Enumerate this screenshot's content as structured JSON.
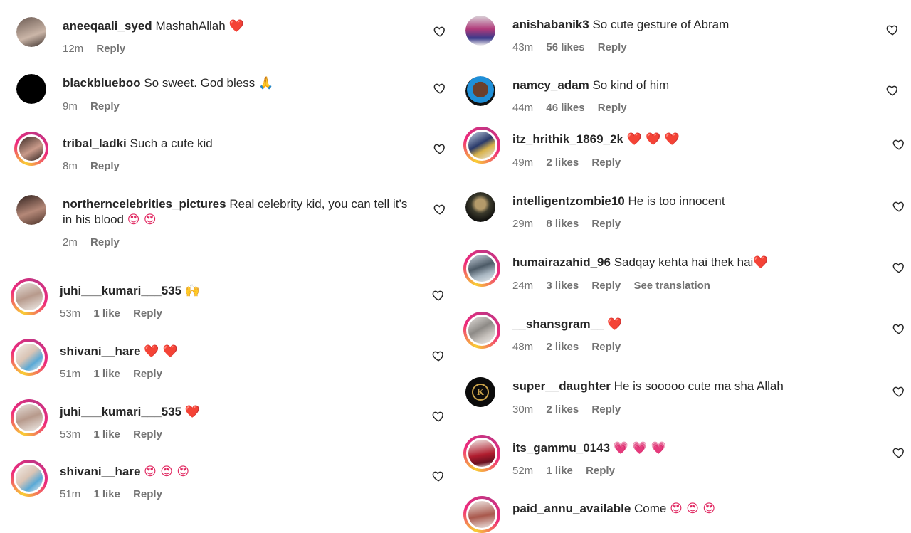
{
  "left_comments": [
    {
      "user": "aneeqaali_syed",
      "text": "MashahAllah",
      "emoji": "❤️",
      "time": "12m",
      "likes": "",
      "reply": "Reply"
    },
    {
      "user": "blackblueboo",
      "text": "So sweet. God bless",
      "emoji": "🙏",
      "time": "9m",
      "likes": "",
      "reply": "Reply"
    },
    {
      "user": "tribal_ladki",
      "text": "Such a cute kid",
      "emoji": "",
      "time": "8m",
      "likes": "",
      "reply": "Reply"
    },
    {
      "user": "northerncelebrities_pictures",
      "text": "Real celebrity kid, you can tell it’s in his blood",
      "emoji": "😍 😍",
      "time": "2m",
      "likes": "",
      "reply": "Reply"
    },
    {
      "user": "juhi___kumari___535",
      "text": "",
      "emoji": "🙌",
      "time": "53m",
      "likes": "1 like",
      "reply": "Reply"
    },
    {
      "user": "shivani__hare",
      "text": "",
      "emoji": "❤️ ❤️",
      "time": "51m",
      "likes": "1 like",
      "reply": "Reply"
    },
    {
      "user": "juhi___kumari___535",
      "text": "",
      "emoji": "❤️",
      "time": "53m",
      "likes": "1 like",
      "reply": "Reply"
    },
    {
      "user": "shivani__hare",
      "text": "",
      "emoji": "😍 😍 😍",
      "time": "51m",
      "likes": "1 like",
      "reply": "Reply"
    }
  ],
  "right_comments": [
    {
      "user": "anishabanik3",
      "text": "So cute gesture of Abram",
      "emoji": "",
      "time": "43m",
      "likes": "56 likes",
      "reply": "Reply",
      "extra": ""
    },
    {
      "user": "namcy_adam",
      "text": "So kind of him",
      "emoji": "",
      "time": "44m",
      "likes": "46 likes",
      "reply": "Reply",
      "extra": ""
    },
    {
      "user": "itz_hrithik_1869_2k",
      "text": "",
      "emoji": "❤️ ❤️ ❤️",
      "time": "49m",
      "likes": "2 likes",
      "reply": "Reply",
      "extra": ""
    },
    {
      "user": "intelligentzombie10",
      "text": "He is too innocent",
      "emoji": "",
      "time": "29m",
      "likes": "8 likes",
      "reply": "Reply",
      "extra": ""
    },
    {
      "user": "humairazahid_96",
      "text": "Sadqay kehta hai thek hai",
      "emoji": "❤️",
      "time": "24m",
      "likes": "3 likes",
      "reply": "Reply",
      "extra": "See translation"
    },
    {
      "user": "__shansgram__",
      "text": "",
      "emoji": "❤️",
      "time": "48m",
      "likes": "2 likes",
      "reply": "Reply",
      "extra": ""
    },
    {
      "user": "super__daughter",
      "text": "He is sooooo cute ma sha Allah",
      "emoji": "",
      "time": "30m",
      "likes": "2 likes",
      "reply": "Reply",
      "extra": ""
    },
    {
      "user": "its_gammu_0143",
      "text": "",
      "emoji": "💗 💗 💗",
      "time": "52m",
      "likes": "1 like",
      "reply": "Reply",
      "extra": ""
    },
    {
      "user": "paid_annu_available",
      "text": "Come",
      "emoji": "😍 😍 😍",
      "time": "",
      "likes": "",
      "reply": "",
      "extra": ""
    }
  ],
  "colors": {
    "meta": "#737373",
    "text": "#262626",
    "heart_red": "#e0245e"
  }
}
